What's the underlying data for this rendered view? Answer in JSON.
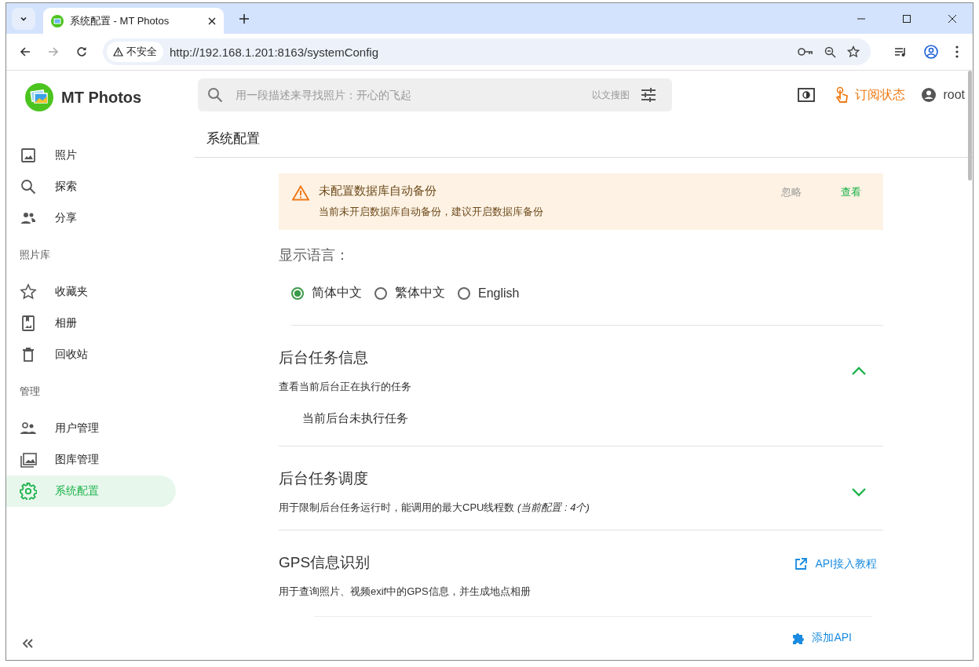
{
  "browser": {
    "tab_title": "系统配置 - MT Photos",
    "security_label": "不安全",
    "url": "http://192.168.1.201:8163/systemConfig"
  },
  "header": {
    "logo_text": "MT Photos",
    "search_placeholder": "用一段描述来寻找照片：开心的飞起",
    "search_hint": "以文搜图",
    "subscription": "订阅状态",
    "user": "root"
  },
  "sidebar": {
    "groups": [
      {
        "items": [
          {
            "kind": "photo",
            "label": "照片",
            "selected": false
          },
          {
            "kind": "search",
            "label": "探索",
            "selected": false
          },
          {
            "kind": "people",
            "label": "分享",
            "selected": false
          }
        ]
      },
      {
        "label": "照片库",
        "items": [
          {
            "kind": "star",
            "label": "收藏夹",
            "selected": false
          },
          {
            "kind": "album",
            "label": "相册",
            "selected": false
          },
          {
            "kind": "trash",
            "label": "回收站",
            "selected": false
          }
        ]
      },
      {
        "label": "管理",
        "items": [
          {
            "kind": "users",
            "label": "用户管理",
            "selected": false
          },
          {
            "kind": "library",
            "label": "图库管理",
            "selected": false
          },
          {
            "kind": "gear",
            "label": "系统配置",
            "selected": true
          }
        ]
      }
    ]
  },
  "page_title": "系统配置",
  "alert": {
    "title": "未配置数据库自动备份",
    "message": "当前未开启数据库自动备份，建议开启数据库备份",
    "actions": [
      "忽略",
      "查看"
    ]
  },
  "language": {
    "label": "显示语言：",
    "options": [
      {
        "label": "简体中文",
        "selected": true
      },
      {
        "label": "繁体中文",
        "selected": false
      },
      {
        "label": "English",
        "selected": false
      }
    ]
  },
  "sections": [
    {
      "kind": "collapsible",
      "title": "后台任务信息",
      "description": "查看当前后台正在执行的任务",
      "expanded": true,
      "body": "当前后台未执行任务"
    },
    {
      "kind": "collapsible",
      "title": "后台任务调度",
      "description": "用于限制后台任务运行时，能调用的最大CPU线程数 *(当前配置 : 4个)*",
      "expanded": false
    },
    {
      "kind": "link",
      "title": "GPS信息识别",
      "description": "用于查询照片、视频exif中的GPS信息，并生成地点相册",
      "link": "API接入教程",
      "add_button": "添加API"
    }
  ]
}
